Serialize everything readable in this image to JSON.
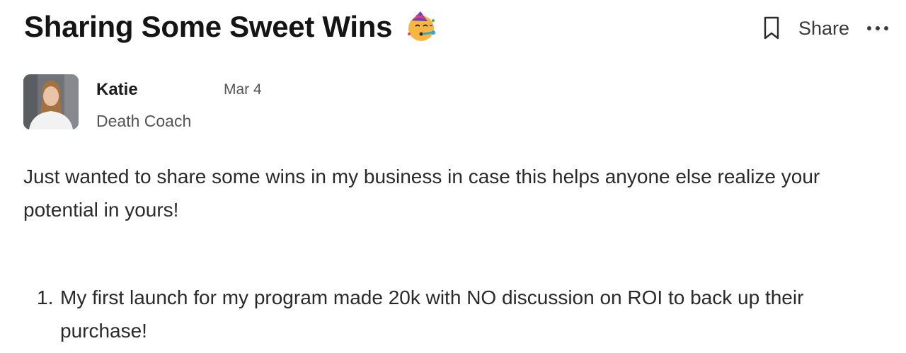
{
  "post": {
    "title": "Sharing Some Sweet Wins",
    "title_icon": "partying-face-emoji",
    "actions": {
      "bookmark_icon": "bookmark-icon",
      "share_label": "Share",
      "more_icon": "more-horizontal-icon"
    },
    "author": {
      "name": "Katie",
      "role": "Death Coach",
      "date": "Mar 4"
    },
    "body": "Just wanted to share some wins in my business in case this helps anyone else realize your potential in yours!",
    "wins": [
      {
        "number": "1.",
        "text": "My first launch for my program made 20k with NO discussion on ROI to back up their purchase!"
      }
    ]
  }
}
